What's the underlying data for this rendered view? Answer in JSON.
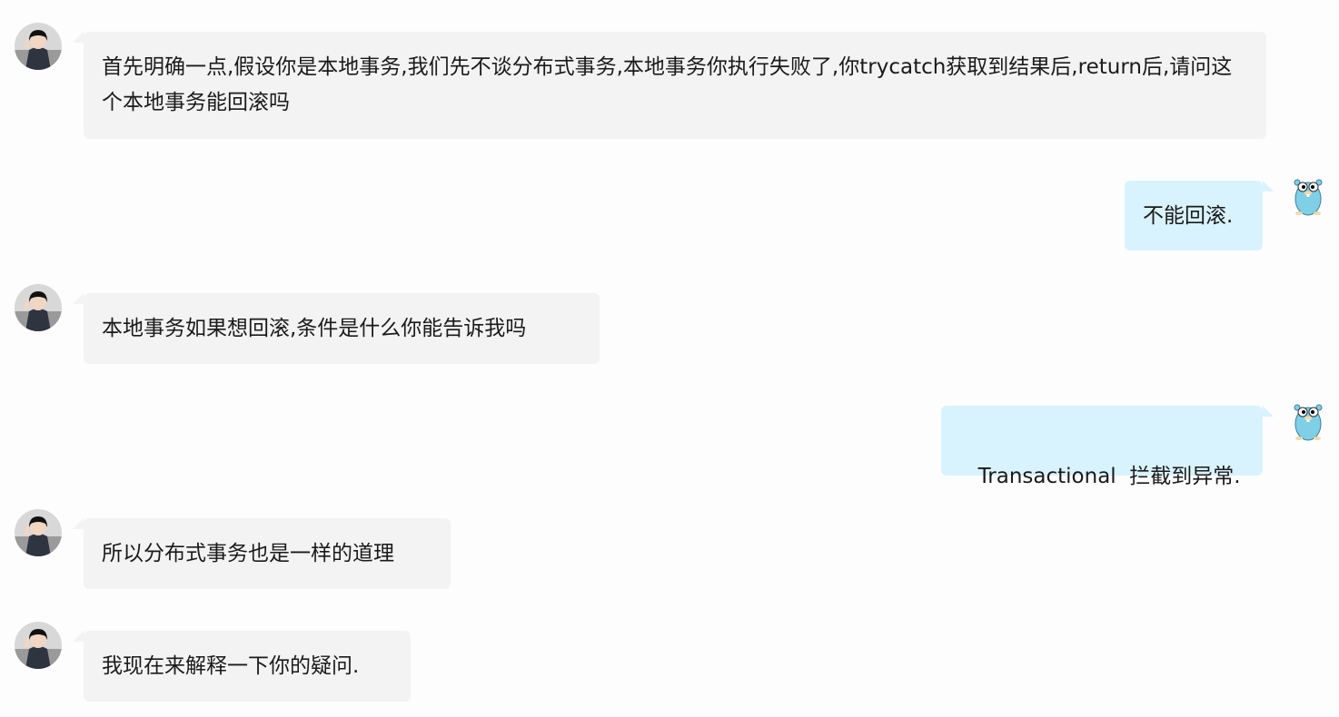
{
  "messages": [
    {
      "side": "left",
      "text": "首先明确一点,假设你是本地事务,我们先不谈分布式事务,本地事务你执行失败了,你trycatch获取到结果后,return后,请问这个本地事务能回滚吗",
      "avatar": "user-avatar"
    },
    {
      "side": "right",
      "text": "不能回滚.",
      "avatar": "gopher-avatar"
    },
    {
      "side": "left",
      "text": "本地事务如果想回滚,条件是什么你能告诉我吗",
      "avatar": "user-avatar"
    },
    {
      "side": "right",
      "text": "Transactional  拦截到异常.",
      "avatar": "gopher-avatar"
    },
    {
      "side": "left",
      "text": "所以分布式事务也是一样的道理",
      "avatar": "user-avatar"
    },
    {
      "side": "left",
      "text": "我现在来解释一下你的疑问.",
      "avatar": "user-avatar"
    }
  ],
  "colors": {
    "left_bubble": "#f3f3f3",
    "right_bubble": "#d9f3fe",
    "background": "#fdfdfd",
    "gopher": "#7fcfe6"
  }
}
